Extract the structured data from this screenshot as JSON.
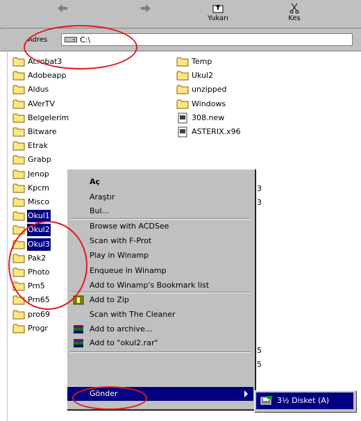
{
  "toolbar": {
    "buttons": [
      {
        "label": "",
        "icon": "back-icon"
      },
      {
        "label": "",
        "icon": "forward-icon"
      },
      {
        "label": "Yukarı",
        "icon": "up-folder-icon"
      },
      {
        "label": "Kes",
        "icon": "cut-icon"
      }
    ]
  },
  "address_bar": {
    "label": "Adres",
    "value": "C:\\",
    "icon": "drive-icon"
  },
  "files": {
    "left": [
      "Acrobat3",
      "Adobeapp",
      "Aldus",
      "AVerTV",
      "Belgelerim",
      "Bitware",
      "Etrak",
      "Grabp",
      "Jenop",
      "Kpcm",
      "Misco",
      "Okul1",
      "Okul2",
      "Okul3",
      "Pak2",
      "Photo",
      "Prn5",
      "Prn65",
      "pro69",
      "Progr"
    ],
    "right": [
      "Temp",
      "Ukul2",
      "unzipped",
      "Windows",
      "308.new",
      "ASTERIX.x96"
    ],
    "selected": [
      "Okul1",
      "Okul2",
      "Okul3"
    ],
    "right_fragments": [
      "3",
      "3",
      "5",
      "5"
    ]
  },
  "context_menu": {
    "items": [
      {
        "label": "Aç",
        "bold": true,
        "icon": ""
      },
      {
        "label": "Araştır",
        "icon": ""
      },
      {
        "label": "Bul...",
        "icon": ""
      },
      {
        "label": "Browse with ACDSee",
        "icon": ""
      },
      {
        "label": "Scan with F-Prot",
        "icon": ""
      },
      {
        "label": "Play in Winamp",
        "icon": ""
      },
      {
        "label": "Enqueue in Winamp",
        "icon": ""
      },
      {
        "label": "Add to Winamp's Bookmark list",
        "icon": ""
      },
      {
        "label": "Add to Zip",
        "icon": "zip-icon"
      },
      {
        "label": "Scan with The Cleaner",
        "icon": ""
      },
      {
        "label": "Add to archive...",
        "icon": "rar-icon"
      },
      {
        "label": "Add to \"okul2.rar\"",
        "icon": "rar-icon"
      },
      {
        "label": "Gönder",
        "icon": "",
        "submenu": true
      }
    ]
  },
  "submenu": {
    "items": [
      {
        "label": "3½ Disket (A)",
        "icon": "floppy-icon"
      }
    ]
  },
  "colors": {
    "annotation": "#e3171b",
    "selection": "#000080",
    "chrome": "#c0c0c0"
  }
}
